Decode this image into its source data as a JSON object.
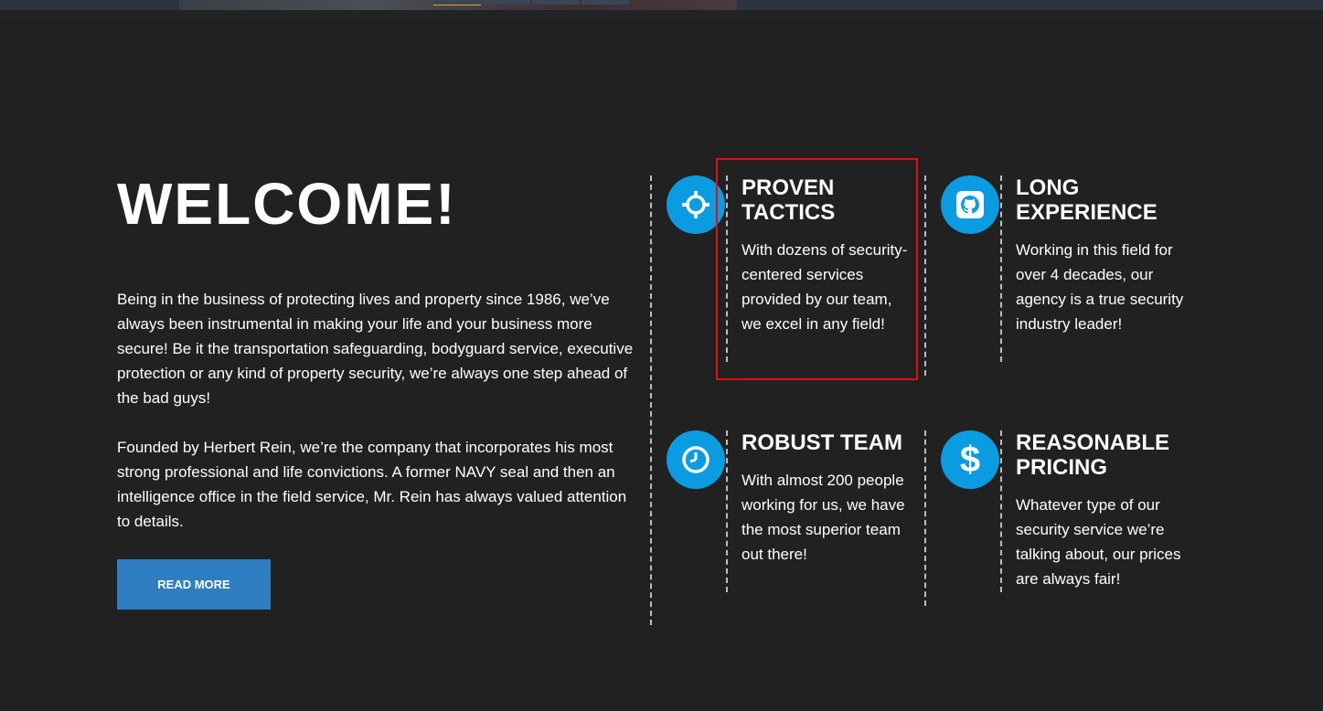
{
  "welcome": {
    "title": "WELCOME!",
    "paragraph1": "Being in the business of protecting lives and property since 1986, we’ve always been instrumental in making your life and your business more secure! Be it the transportation safeguarding, bodyguard service, executive protection or any kind of property security, we’re always one step ahead of the bad guys!",
    "paragraph2": "Founded by Herbert Rein, we’re the company that incorporates his most strong professional and life convictions. A former NAVY seal and then an intelligence office in the field service, Mr. Rein has always valued attention to details.",
    "read_more_label": "READ MORE"
  },
  "features": [
    {
      "icon": "crosshair-icon",
      "title_line1": "PROVEN",
      "title_line2": "TACTICS",
      "text": "With dozens of security-centered services provided by our team, we excel in any field!"
    },
    {
      "icon": "github-icon",
      "title_line1": "LONG",
      "title_line2": "EXPERIENCE",
      "text": "Working in this field for over 4 decades, our agency is a true security industry leader!"
    },
    {
      "icon": "clock-icon",
      "title_line1": "ROBUST TEAM",
      "title_line2": "",
      "text": "With almost 200 people working for us, we have the most superior team out there!"
    },
    {
      "icon": "dollar-icon",
      "title_line1": "REASONABLE",
      "title_line2": "PRICING",
      "text": "Whatever type of our security service we’re talking about, our prices are always fair!"
    }
  ],
  "colors": {
    "background": "#212121",
    "accent_blue": "#0b9be0",
    "button_blue": "#2d7dc0",
    "highlight_red": "#e01010"
  }
}
